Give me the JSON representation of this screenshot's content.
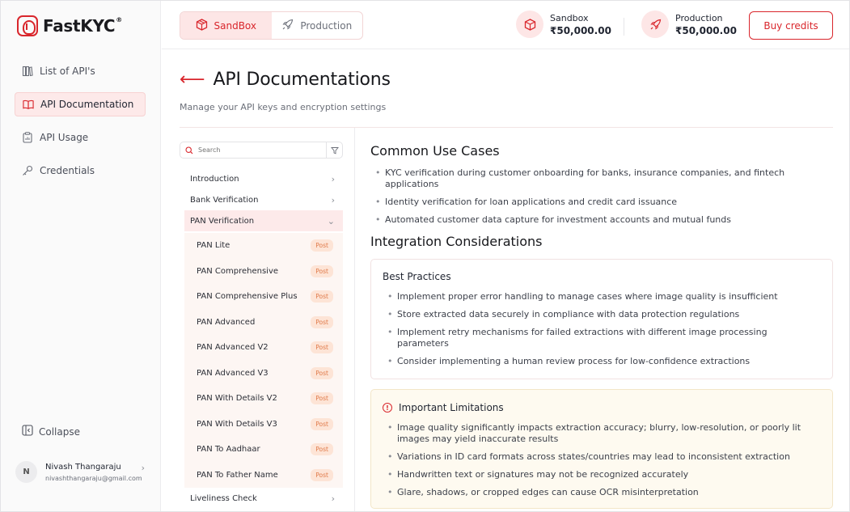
{
  "app": {
    "logo_text": "FastKYC",
    "logo_reg": "®"
  },
  "sidebar": {
    "items": [
      {
        "label": "List of API's",
        "icon": "book-stack-icon"
      },
      {
        "label": "API Documentation",
        "icon": "open-book-icon",
        "active": true
      },
      {
        "label": "API Usage",
        "icon": "clipboard-icon"
      },
      {
        "label": "Credentials",
        "icon": "key-icon"
      }
    ],
    "collapse_label": "Collapse",
    "user": {
      "initial": "N",
      "name": "Nivash Thangaraju",
      "email": "nivashthangaraju@gmail.com"
    }
  },
  "header": {
    "env_tabs": [
      {
        "label": "SandBox",
        "active": true
      },
      {
        "label": "Production",
        "active": false
      }
    ],
    "balances": [
      {
        "label": "Sandbox",
        "value": "₹50,000.00"
      },
      {
        "label": "Production",
        "value": "₹50,000.00"
      }
    ],
    "buy_label": "Buy credits"
  },
  "page": {
    "title": "API Documentations",
    "subtitle": "Manage your API keys and encryption settings"
  },
  "tree": {
    "search_placeholder": "Search",
    "categories": [
      {
        "label": "Introduction"
      },
      {
        "label": "Bank Verification"
      },
      {
        "label": "PAN Verification",
        "open": true
      }
    ],
    "items": [
      {
        "label": "PAN Lite",
        "method": "Post"
      },
      {
        "label": "PAN Comprehensive",
        "method": "Post"
      },
      {
        "label": "PAN Comprehensive Plus",
        "method": "Post"
      },
      {
        "label": "PAN Advanced",
        "method": "Post"
      },
      {
        "label": "PAN Advanced V2",
        "method": "Post"
      },
      {
        "label": "PAN Advanced V3",
        "method": "Post"
      },
      {
        "label": "PAN With Details V2",
        "method": "Post"
      },
      {
        "label": "PAN With Details V3",
        "method": "Post"
      },
      {
        "label": "PAN To Aadhaar",
        "method": "Post"
      },
      {
        "label": "PAN To Father Name",
        "method": "Post"
      }
    ],
    "last_category": "Liveliness Check"
  },
  "content": {
    "use_cases": {
      "title": "Common Use Cases",
      "items": [
        "KYC verification during customer onboarding for banks, insurance companies, and fintech applications",
        "Identity verification for loan applications and credit card issuance",
        "Automated customer data capture for investment accounts and mutual funds"
      ]
    },
    "integration": {
      "title": "Integration Considerations",
      "best_practices": {
        "title": "Best Practices",
        "items": [
          "Implement proper error handling to manage cases where image quality is insufficient",
          "Store extracted data securely in compliance with data protection regulations",
          "Implement retry mechanisms for failed extractions with different image processing parameters",
          "Consider implementing a human review process for low-confidence extractions"
        ]
      },
      "limitations": {
        "title": "Important Limitations",
        "items": [
          "Image quality significantly impacts extraction accuracy; blurry, low-resolution, or poorly lit images may yield inaccurate results",
          "Variations in ID card formats across states/countries may lead to inconsistent extraction",
          "Handwritten text or signatures may not be recognized accurately",
          "Glare, shadows, or cropped edges can cause OCR misinterpretation"
        ]
      }
    }
  },
  "colors": {
    "brand": "#d9262c",
    "active_bg": "#fde9e9",
    "warn_bg": "#fefaf0"
  }
}
